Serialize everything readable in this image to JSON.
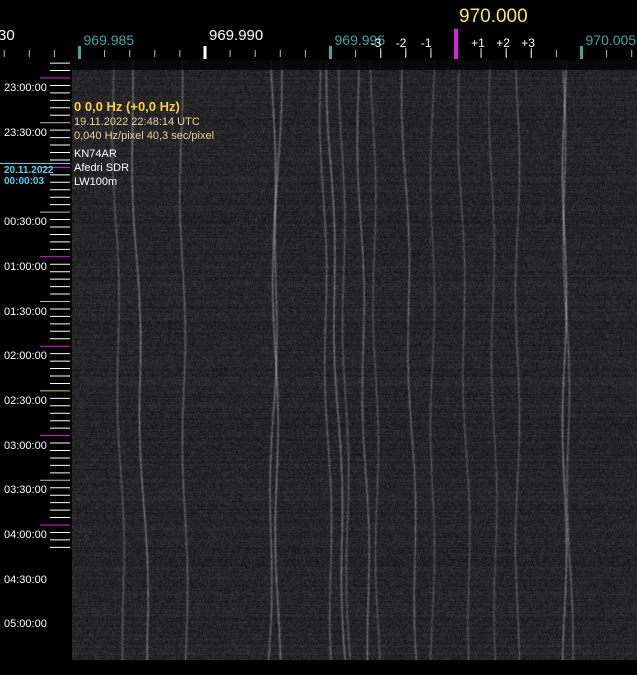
{
  "colors": {
    "background": "#000000",
    "major_tick": "#ffffff",
    "minor_tick": "#3aa7a2",
    "center_marker": "#e020e0",
    "center_label": "#ffe84a",
    "half_hour_tick": "#c8c850",
    "hour_tick": "#e020e0",
    "date_label": "#46d7ee",
    "info_header": "#ffd23a",
    "info_text": "#e8d69a"
  },
  "frequency_scale": {
    "left_cut_label": "30",
    "labels": [
      {
        "text": "969.985",
        "kind": "minor",
        "freq": 969.985
      },
      {
        "text": "969.990",
        "kind": "major",
        "freq": 969.99
      },
      {
        "text": "969.995",
        "kind": "minor",
        "freq": 969.995
      },
      {
        "text": "970.005",
        "kind": "minor",
        "freq": 970.005
      }
    ],
    "center": {
      "text": "970.000",
      "freq": 970.0
    },
    "offset_labels": [
      {
        "text": "-3",
        "offset": -3
      },
      {
        "text": "-2",
        "offset": -2
      },
      {
        "text": "-1",
        "offset": -1
      },
      {
        "text": "+1",
        "offset": 1
      },
      {
        "text": "+2",
        "offset": 2
      },
      {
        "text": "+3",
        "offset": 3
      }
    ]
  },
  "info": {
    "cursor_line": "0 0,0 Hz (+0,0 Hz)",
    "timestamp": "19.11.2022 22:48:14 UTC",
    "resolution": "0,040 Hz/pixel 40,3 sec/pixel",
    "station": "KN74AR",
    "receiver": "Afedri SDR",
    "antenna": "LW100m"
  },
  "time_scale": {
    "labels": [
      {
        "text": "23:00:00",
        "time": "23:00:00"
      },
      {
        "text": "23:30:00",
        "time": "23:30:00"
      },
      {
        "text": "00:30:00",
        "time": "00:30:00"
      },
      {
        "text": "01:00:00",
        "time": "01:00:00"
      },
      {
        "text": "01:30:00",
        "time": "01:30:00"
      },
      {
        "text": "02:00:00",
        "time": "02:00:00"
      },
      {
        "text": "02:30:00",
        "time": "02:30:00"
      },
      {
        "text": "03:00:00",
        "time": "03:00:00"
      },
      {
        "text": "03:30:00",
        "time": "03:30:00"
      },
      {
        "text": "04:00:00",
        "time": "04:00:00"
      },
      {
        "text": "04:30:00",
        "time": "04:30:00"
      },
      {
        "text": "05:00:00",
        "time": "05:00:00"
      }
    ],
    "date_marker": {
      "date": "20.11.2022",
      "time": "00:00:03"
    }
  }
}
